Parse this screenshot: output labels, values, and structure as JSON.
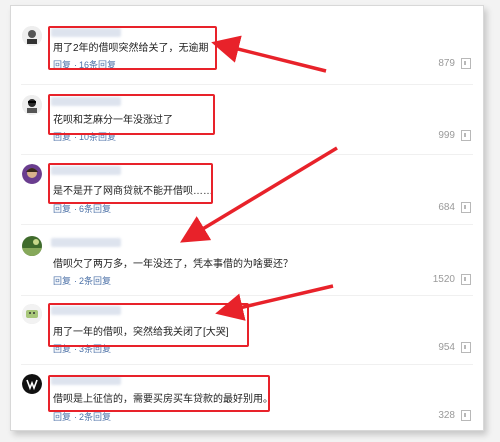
{
  "comments": [
    {
      "text": "用了2年的借呗突然给关了，无逾期",
      "reply_label": "回复",
      "replies": "16条回复",
      "likes": "879"
    },
    {
      "text": "花呗和芝麻分一年没涨过了",
      "reply_label": "回复",
      "replies": "10条回复",
      "likes": "999"
    },
    {
      "text": "是不是开了网商贷就不能开借呗……",
      "reply_label": "回复",
      "replies": "6条回复",
      "likes": "684"
    },
    {
      "text": "借呗欠了两万多，一年没还了，凭本事借的为啥要还？",
      "reply_label": "回复",
      "replies": "2条回复",
      "likes": "1520"
    },
    {
      "text": "用了一年的借呗，突然给我关闭了[大哭]",
      "reply_label": "回复",
      "replies": "3条回复",
      "likes": "954"
    },
    {
      "text": "借呗是上征信的，需要买房买车贷款的最好别用。",
      "reply_label": "回复",
      "replies": "2条回复",
      "likes": "328"
    }
  ],
  "colors": {
    "highlight": "#e8222a",
    "link": "#4d72a8"
  },
  "icons": [
    "thumb-up-icon"
  ]
}
